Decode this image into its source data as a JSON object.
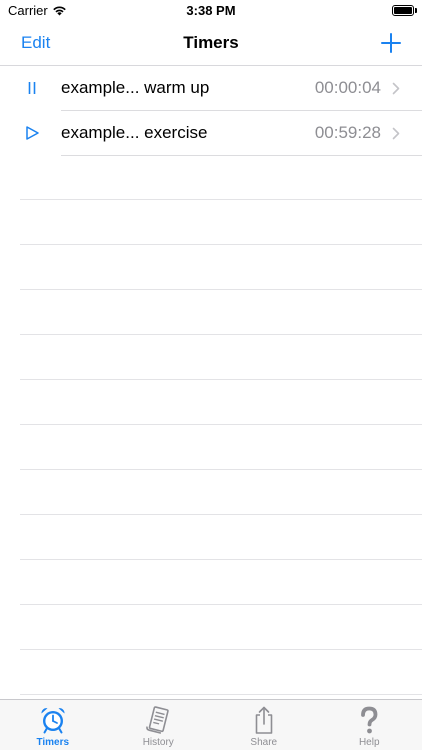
{
  "status_bar": {
    "carrier": "Carrier",
    "time": "3:38 PM"
  },
  "nav": {
    "edit_label": "Edit",
    "title": "Timers",
    "add_icon": "plus-icon"
  },
  "timers": [
    {
      "state_icon": "pause-icon",
      "title": "example... warm up",
      "time": "00:00:04"
    },
    {
      "state_icon": "play-icon",
      "title": "example... exercise",
      "time": "00:59:28"
    }
  ],
  "tabs": [
    {
      "label": "Timers",
      "icon": "alarm-clock-icon",
      "active": true
    },
    {
      "label": "History",
      "icon": "scroll-icon",
      "active": false
    },
    {
      "label": "Share",
      "icon": "share-icon",
      "active": false
    },
    {
      "label": "Help",
      "icon": "question-mark-icon",
      "active": false
    }
  ],
  "colors": {
    "accent": "#1a82f0",
    "secondary_text": "#8e8e93",
    "tab_bar_bg": "#f7f7f7"
  }
}
